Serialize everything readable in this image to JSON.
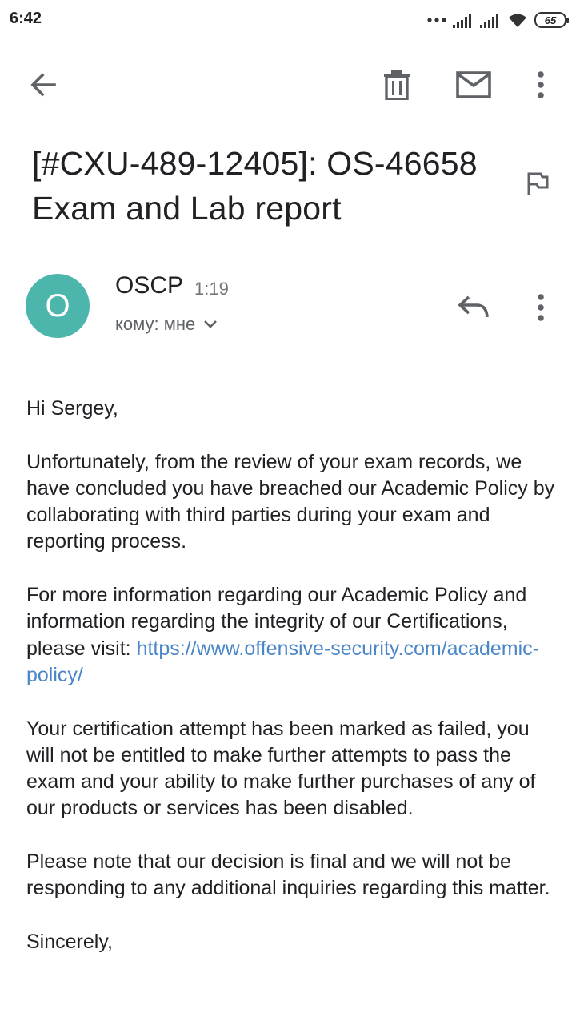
{
  "status_bar": {
    "time": "6:42",
    "battery": "65"
  },
  "toolbar": {
    "back_icon": "arrow-back-icon",
    "delete_icon": "trash-icon",
    "mark_unread_icon": "mail-icon",
    "more_icon": "more-vert-icon"
  },
  "email": {
    "subject": "[#CXU-489-12405]: OS-46658 Exam and Lab report",
    "sender_initial": "O",
    "sender_name": "OSCP",
    "time": "1:19",
    "recipient": "кому: мне",
    "avatar_color": "#4db6ac",
    "link_color": "#4a86c8",
    "body": {
      "greeting": "Hi Sergey,",
      "para1": "Unfortunately, from the review of your exam records, we have concluded you have breached our Academic Policy by collaborating with third parties during your exam and reporting process.",
      "para2_text": "For more information regarding our Academic Policy and information regarding the integrity of our Certifications, please visit: ",
      "para2_link": "https://www.offensive-security.com/academic-policy/",
      "para3": "Your certification attempt has been marked as failed, you will not be entitled to make further attempts to pass the exam and your ability to make further purchases of any of our products or services has been disabled.",
      "para4": "Please note that our decision is final and we will not be responding to any additional inquiries regarding this matter.",
      "closing": "Sincerely,"
    }
  }
}
